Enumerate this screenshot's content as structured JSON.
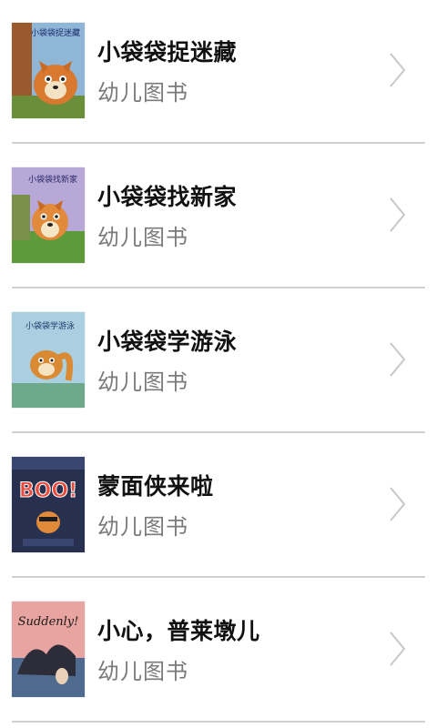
{
  "books": [
    {
      "title": "小袋袋捉迷藏",
      "category": "幼儿图书",
      "cover_icon": "kangaroo-hide-and-seek-cover",
      "cover_text": "小袋袋捉迷藏"
    },
    {
      "title": "小袋袋找新家",
      "category": "幼儿图书",
      "cover_icon": "kangaroo-new-home-cover",
      "cover_text": "小袋袋找新家"
    },
    {
      "title": "小袋袋学游泳",
      "category": "幼儿图书",
      "cover_icon": "kangaroo-swimming-cover",
      "cover_text": "小袋袋学游泳"
    },
    {
      "title": "蒙面侠来啦",
      "category": "幼儿图书",
      "cover_icon": "boo-cover",
      "cover_text": "BOO!"
    },
    {
      "title": "小心，普莱墩儿",
      "category": "幼儿图书",
      "cover_icon": "suddenly-cover",
      "cover_text": "Suddenly!"
    }
  ],
  "colors": {
    "title": "#111111",
    "subtitle": "#7a7a7a",
    "divider": "#cfcfcf",
    "chevron": "#c8c8c8"
  }
}
